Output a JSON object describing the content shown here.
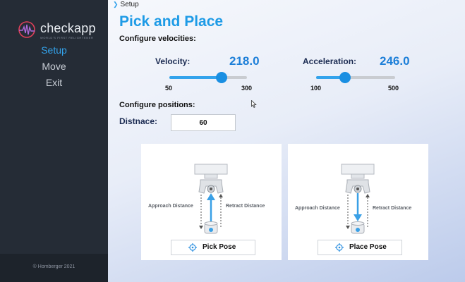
{
  "app": {
    "name": "checkapp",
    "tagline": "WORLD'S FIRST RELIGHTENER"
  },
  "sidebar": {
    "items": [
      {
        "label": "Setup",
        "active": true
      },
      {
        "label": "Move",
        "active": false
      },
      {
        "label": "Exit",
        "active": false
      }
    ],
    "footer": "© Homberger 2021"
  },
  "breadcrumb": "Setup",
  "page_title": "Pick and Place",
  "velocities": {
    "heading": "Configure velocities:",
    "velocity": {
      "label": "Velocity:",
      "value": "218.0",
      "min": "50",
      "max": "300",
      "fraction": 0.672
    },
    "acceleration": {
      "label": "Acceleration:",
      "value": "246.0",
      "min": "100",
      "max": "500",
      "fraction": 0.365
    }
  },
  "positions": {
    "heading": "Configure positions:",
    "distance_label": "Distnace:",
    "distance_value": "60"
  },
  "pick_panel": {
    "approach_label": "Approach Distance",
    "retract_label": "Retract Distance",
    "button_label": "Pick Pose",
    "icon": "target-icon"
  },
  "place_panel": {
    "approach_label": "Approach Distance",
    "retract_label": "Retract Distance",
    "button_label": "Place Pose",
    "icon": "target-icon"
  },
  "colors": {
    "accent": "#33a3ec",
    "title": "#1e9be6",
    "sidebar": "#252c36",
    "arrow": "#3aa0e6"
  }
}
